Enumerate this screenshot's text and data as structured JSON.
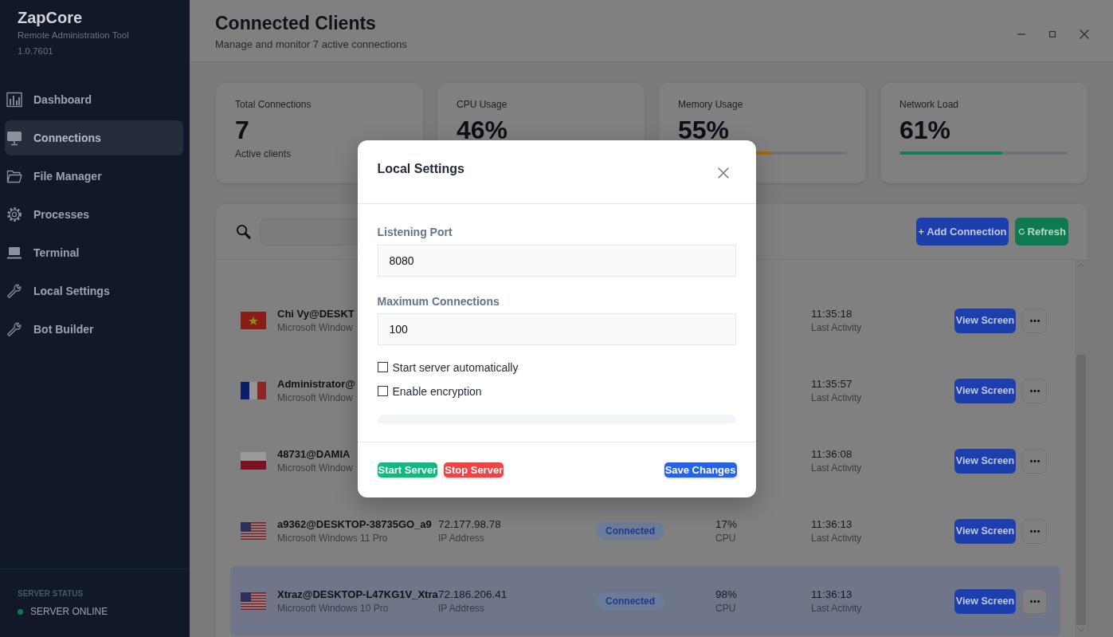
{
  "sidebar": {
    "brand": "ZapCore",
    "subtitle": "Remote Administration Tool",
    "version": "1.0.7601",
    "items": [
      {
        "label": "Dashboard",
        "selected": false
      },
      {
        "label": "Connections",
        "selected": true
      },
      {
        "label": "File Manager",
        "selected": false
      },
      {
        "label": "Processes",
        "selected": false
      },
      {
        "label": "Terminal",
        "selected": false
      },
      {
        "label": "Local Settings",
        "selected": false
      },
      {
        "label": "Bot Builder",
        "selected": false
      }
    ],
    "status": {
      "heading": "SERVER STATUS",
      "label": "SERVER ONLINE",
      "online": true
    }
  },
  "header": {
    "title": "Connected Clients",
    "subtitle": "Manage and monitor 7 active connections"
  },
  "stats": [
    {
      "kind": "count",
      "label": "Total Connections",
      "value": "7",
      "caption": "Active clients"
    },
    {
      "kind": "meter",
      "label": "CPU Usage",
      "value": "46%"
    },
    {
      "kind": "meter",
      "label": "Memory Usage",
      "value": "55%",
      "level": 0.55,
      "color": "#a5680c"
    },
    {
      "kind": "meter",
      "label": "Network Load",
      "value": "61%",
      "level": 0.61,
      "color": "#10805a"
    }
  ],
  "toolbar": {
    "buttons": [
      {
        "kind": "add",
        "label": "+ Add Connection"
      },
      {
        "kind": "refresh",
        "label": "Refresh"
      }
    ]
  },
  "rows": [
    {
      "name": "Chi Vy@DESKT",
      "os": "Microsoft Window",
      "time": "11:35:18",
      "time_label": "Last Activity",
      "action": "View Screen",
      "selected": false
    },
    {
      "name": "Administrator@",
      "os": "Microsoft Window",
      "time": "11:35:57",
      "time_label": "Last Activity",
      "action": "View Screen",
      "selected": false
    },
    {
      "name": "48731@DAMIA",
      "os": "Microsoft Window",
      "time": "11:36:08",
      "time_label": "Last Activity",
      "action": "View Screen",
      "selected": false
    },
    {
      "name": "a9362@DESKTOP-38735GO_a9",
      "os": "Microsoft Windows 11 Pro",
      "ip": "72.177.98.78",
      "ip_label": "IP Address",
      "status": "Connected",
      "cpu": "17%",
      "cpu_label": "CPU",
      "time": "11:36:13",
      "time_label": "Last Activity",
      "action": "View Screen",
      "selected": false
    },
    {
      "name": "Xtraz@DESKTOP-L47KG1V_Xtra",
      "os": "Microsoft Windows 10 Pro",
      "ip": "72.186.206.41",
      "ip_label": "IP Address",
      "status": "Connected",
      "cpu": "98%",
      "cpu_label": "CPU",
      "time": "11:36:13",
      "time_label": "Last Activity",
      "action": "View Screen",
      "selected": true
    }
  ],
  "modal": {
    "title": "Local Settings",
    "fields": [
      {
        "label": "Listening Port",
        "value": "8080"
      },
      {
        "label": "Maximum Connections",
        "value": "100"
      }
    ],
    "options": [
      {
        "label": "Start server automatically",
        "checked": false
      },
      {
        "label": "Enable encryption",
        "checked": false
      }
    ],
    "buttons": [
      {
        "kind": "start",
        "label": "Start Server"
      },
      {
        "kind": "stop",
        "label": "Stop Server"
      },
      {
        "kind": "save",
        "label": "Save Changes"
      }
    ]
  }
}
